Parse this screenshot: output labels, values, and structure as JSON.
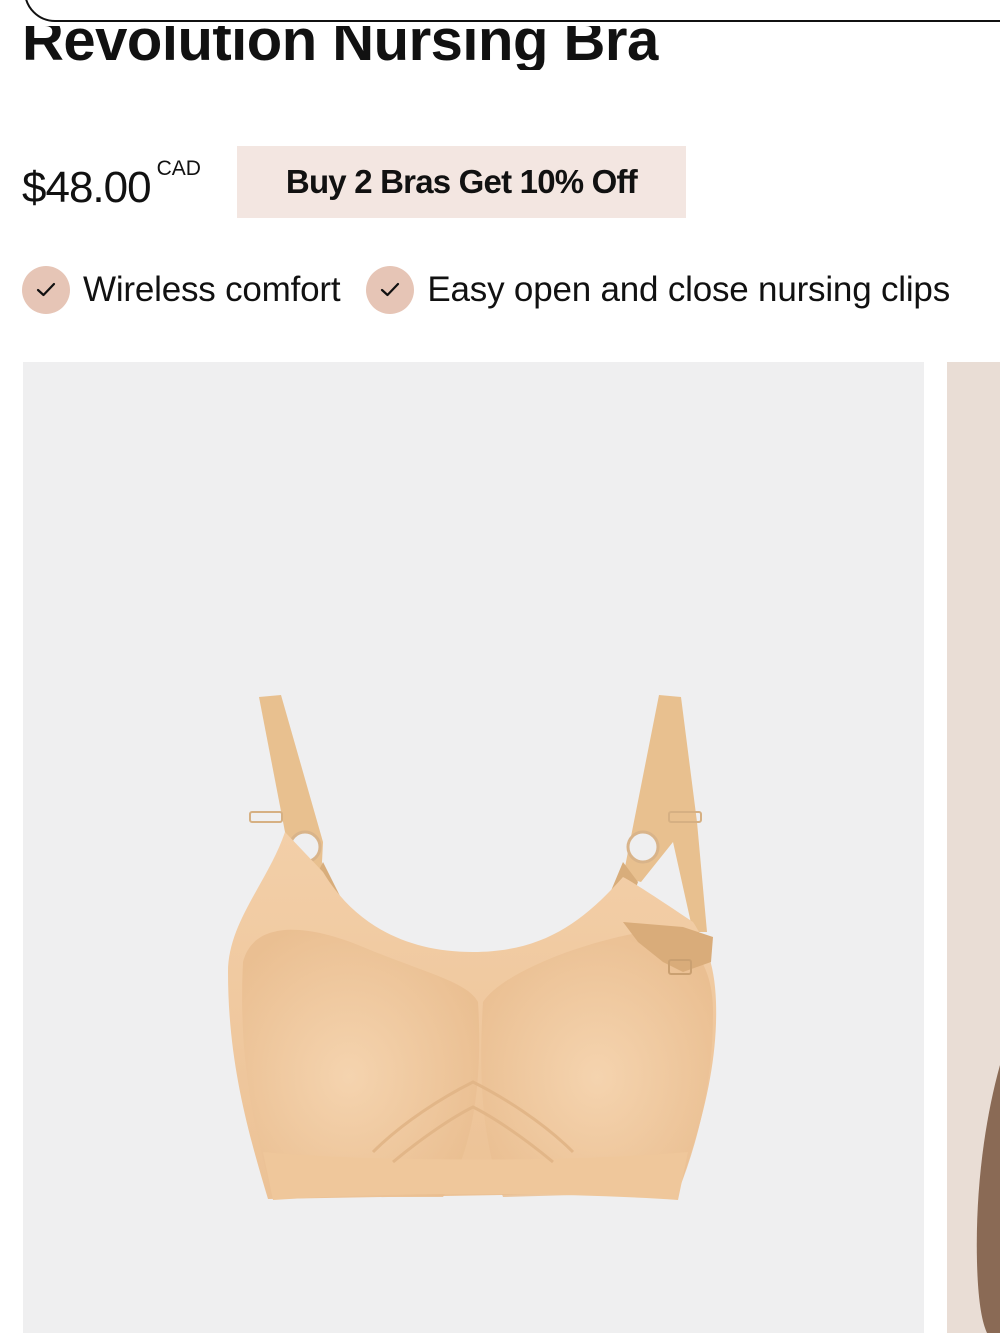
{
  "product": {
    "title": "Revolution Nursing Bra",
    "price": "$48.00",
    "currency": "CAD",
    "promo": "Buy 2 Bras Get 10% Off"
  },
  "features": [
    {
      "label": "Wireless comfort",
      "icon": "check-icon"
    },
    {
      "label": "Easy open and close nursing clips",
      "icon": "check-icon"
    }
  ],
  "gallery": {
    "images": [
      {
        "subject": "nude nursing bra product photo"
      },
      {
        "subject": "model wearing bra"
      }
    ]
  },
  "colors": {
    "accent_badge": "#e6c5b6",
    "promo_background": "#f3e6e1",
    "image_background": "#efeff0",
    "product_color": "#f0c9a0"
  }
}
